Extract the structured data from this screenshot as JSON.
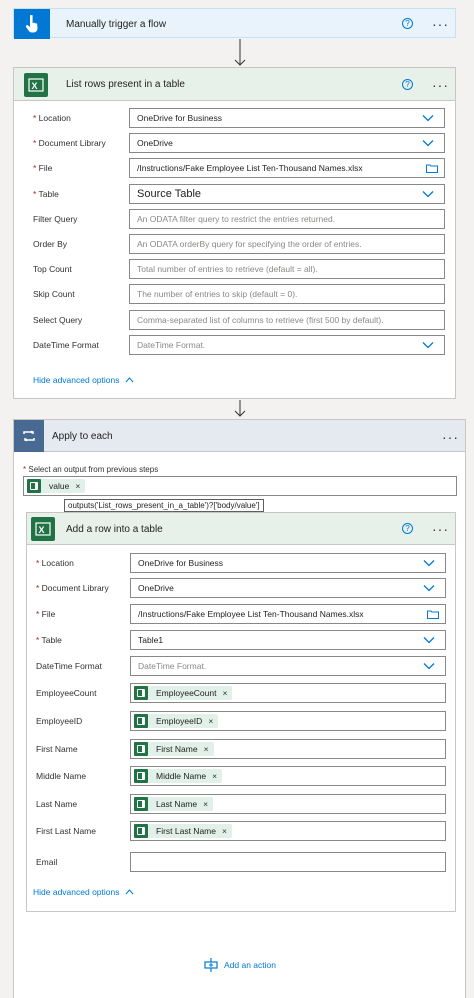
{
  "trigger": {
    "title": "Manually trigger a flow",
    "help": "?",
    "more": "···"
  },
  "list_rows": {
    "title": "List rows present in a table",
    "help": "?",
    "more": "···",
    "fields": [
      {
        "label": "Location",
        "required": true,
        "value": "OneDrive for Business",
        "type": "dropdown"
      },
      {
        "label": "Document Library",
        "required": true,
        "value": "OneDrive",
        "type": "dropdown"
      },
      {
        "label": "File",
        "required": true,
        "value": "/Instructions/Fake Employee List Ten-Thousand Names.xlsx",
        "type": "file"
      },
      {
        "label": "Table",
        "required": true,
        "value": "Source Table",
        "type": "dropdown"
      },
      {
        "label": "Filter Query",
        "required": false,
        "placeholder": "An ODATA filter query to restrict the entries returned.",
        "type": "text"
      },
      {
        "label": "Order By",
        "required": false,
        "placeholder": "An ODATA orderBy query for specifying the order of entries.",
        "type": "text"
      },
      {
        "label": "Top Count",
        "required": false,
        "placeholder": "Total number of entries to retrieve (default = all).",
        "type": "text"
      },
      {
        "label": "Skip Count",
        "required": false,
        "placeholder": "The number of entries to skip (default = 0).",
        "type": "text"
      },
      {
        "label": "Select Query",
        "required": false,
        "placeholder": "Comma-separated list of columns to retrieve (first 500 by default).",
        "type": "text"
      },
      {
        "label": "DateTime Format",
        "required": false,
        "placeholder": "DateTime Format.",
        "type": "dropdown"
      }
    ],
    "hide_advanced": "Hide advanced options"
  },
  "apply_each": {
    "title": "Apply to each",
    "more": "···",
    "select_label": "Select an output from previous steps",
    "token": "value",
    "tooltip": "outputs('List_rows_present_in_a_table')?['body/value']"
  },
  "add_row": {
    "title": "Add a row into a table",
    "help": "?",
    "more": "···",
    "fields": [
      {
        "label": "Location",
        "required": true,
        "value": "OneDrive for Business",
        "type": "dropdown"
      },
      {
        "label": "Document Library",
        "required": true,
        "value": "OneDrive",
        "type": "dropdown"
      },
      {
        "label": "File",
        "required": true,
        "value": "/Instructions/Fake Employee List Ten-Thousand Names.xlsx",
        "type": "file"
      },
      {
        "label": "Table",
        "required": true,
        "value": "Table1",
        "type": "dropdown"
      },
      {
        "label": "DateTime Format",
        "required": false,
        "placeholder": "DateTime Format.",
        "type": "dropdown"
      },
      {
        "label": "EmployeeCount",
        "required": false,
        "token": "EmployeeCount",
        "type": "token"
      },
      {
        "label": "EmployeeID",
        "required": false,
        "token": "EmployeeID",
        "type": "token"
      },
      {
        "label": "First Name",
        "required": false,
        "token": "First Name",
        "type": "token"
      },
      {
        "label": "Middle Name",
        "required": false,
        "token": "Middle Name",
        "type": "token"
      },
      {
        "label": "Last Name",
        "required": false,
        "token": "Last Name",
        "type": "token"
      },
      {
        "label": "First Last Name",
        "required": false,
        "token": "First Last Name",
        "type": "token"
      },
      {
        "label": "Email",
        "required": false,
        "value": "",
        "type": "text"
      }
    ],
    "hide_advanced": "Hide advanced options"
  },
  "add_action": "Add an action",
  "colors": {
    "trigger_accent": "#0078d4",
    "excel_green": "#217346",
    "apply_accent": "#486991",
    "link": "#0078d4"
  }
}
